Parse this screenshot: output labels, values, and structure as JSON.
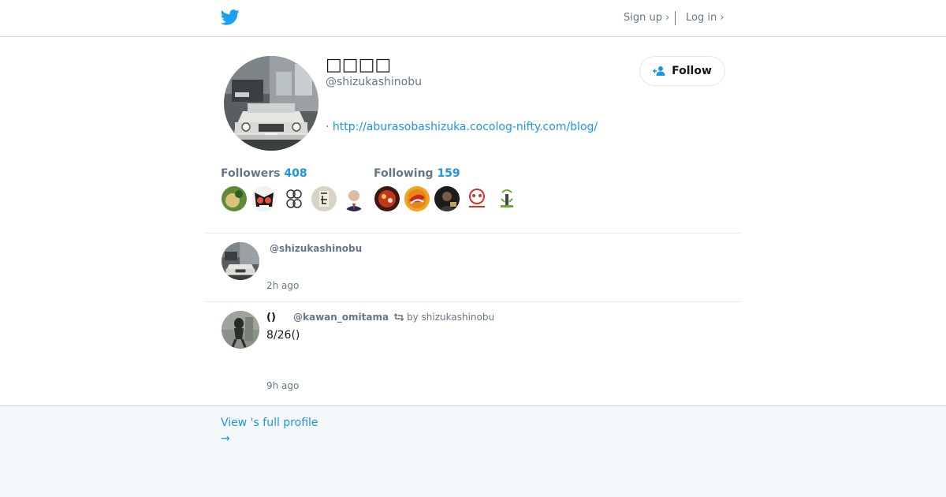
{
  "header": {
    "logo_icon": "twitter-bird-icon",
    "signup_label": "Sign up ›",
    "login_label": "Log in ›"
  },
  "profile": {
    "display_name": "□□□□",
    "screen_name": "@shizukashinobu",
    "url_prefix": "· ",
    "url": "http://aburasobashizuka.cocolog-nifty.com/blog/",
    "follow_label": "Follow",
    "followers_label": "Followers",
    "followers_count": "408",
    "following_label": "Following",
    "following_count": "159"
  },
  "tweets": [
    {
      "name": "",
      "handle": "@shizukashinobu",
      "retweet_by": "",
      "text": "",
      "time": "2h ago"
    },
    {
      "name": "()",
      "handle": "@kawan_omitama",
      "retweet_by": "by shizukashinobu",
      "text": "8/26()",
      "time": "9h ago"
    }
  ],
  "footer": {
    "full_profile_label": "View 's full profile",
    "arrow": "→"
  },
  "colors": {
    "accent": "#1b95e0",
    "muted": "#657786",
    "footer_bg": "#f5f8fa"
  }
}
